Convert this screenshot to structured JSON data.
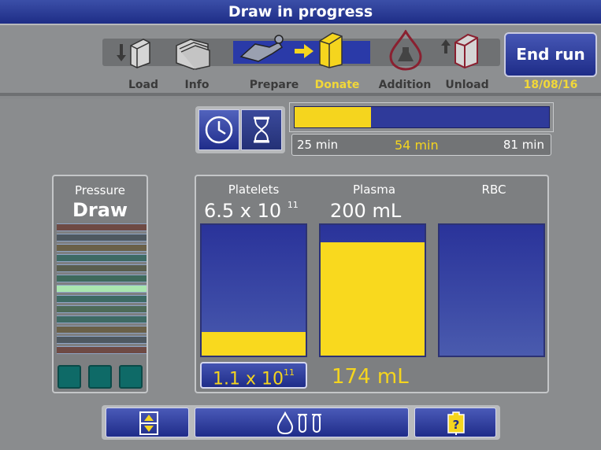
{
  "title": "Draw in progress",
  "steps": [
    {
      "label": "Load",
      "icon": "kit-load-icon",
      "state": "done"
    },
    {
      "label": "Info",
      "icon": "folder-icon",
      "state": "done"
    },
    {
      "label": "Prepare",
      "icon": "donor-icon",
      "state": "done"
    },
    {
      "label": "Donate",
      "icon": "donate-machine-icon",
      "state": "current"
    },
    {
      "label": "Addition",
      "icon": "flask-drop-icon",
      "state": "pending"
    },
    {
      "label": "Unload",
      "icon": "kit-unload-icon",
      "state": "pending"
    }
  ],
  "end_run_label": "End run",
  "date": "18/08/16",
  "timer": {
    "start": "25 min",
    "current": "54 min",
    "end": "81 min",
    "progress_fraction": 0.3
  },
  "pressure": {
    "label": "Pressure",
    "mode": "Draw",
    "highlight_level_index": 6
  },
  "products": {
    "platelets": {
      "name": "Platelets",
      "target_base": "6.5 x 10",
      "target_exp": "11",
      "collected_base": "1.1 x 10",
      "collected_exp": "11",
      "fill_fraction": 0.18
    },
    "plasma": {
      "name": "Plasma",
      "target": "200 mL",
      "collected": "174 mL",
      "fill_fraction": 0.87
    },
    "rbc": {
      "name": "RBC",
      "fill_fraction": 0
    }
  },
  "colors": {
    "accent_yellow": "#f5d51e",
    "button_blue": "#1f2c89",
    "pressure_highlight": "#a9e6b0"
  },
  "bottom_buttons": [
    {
      "icon": "scroll-up-down-icon"
    },
    {
      "icon": "drop-and-tubes-icon"
    },
    {
      "icon": "help-bag-icon"
    }
  ]
}
